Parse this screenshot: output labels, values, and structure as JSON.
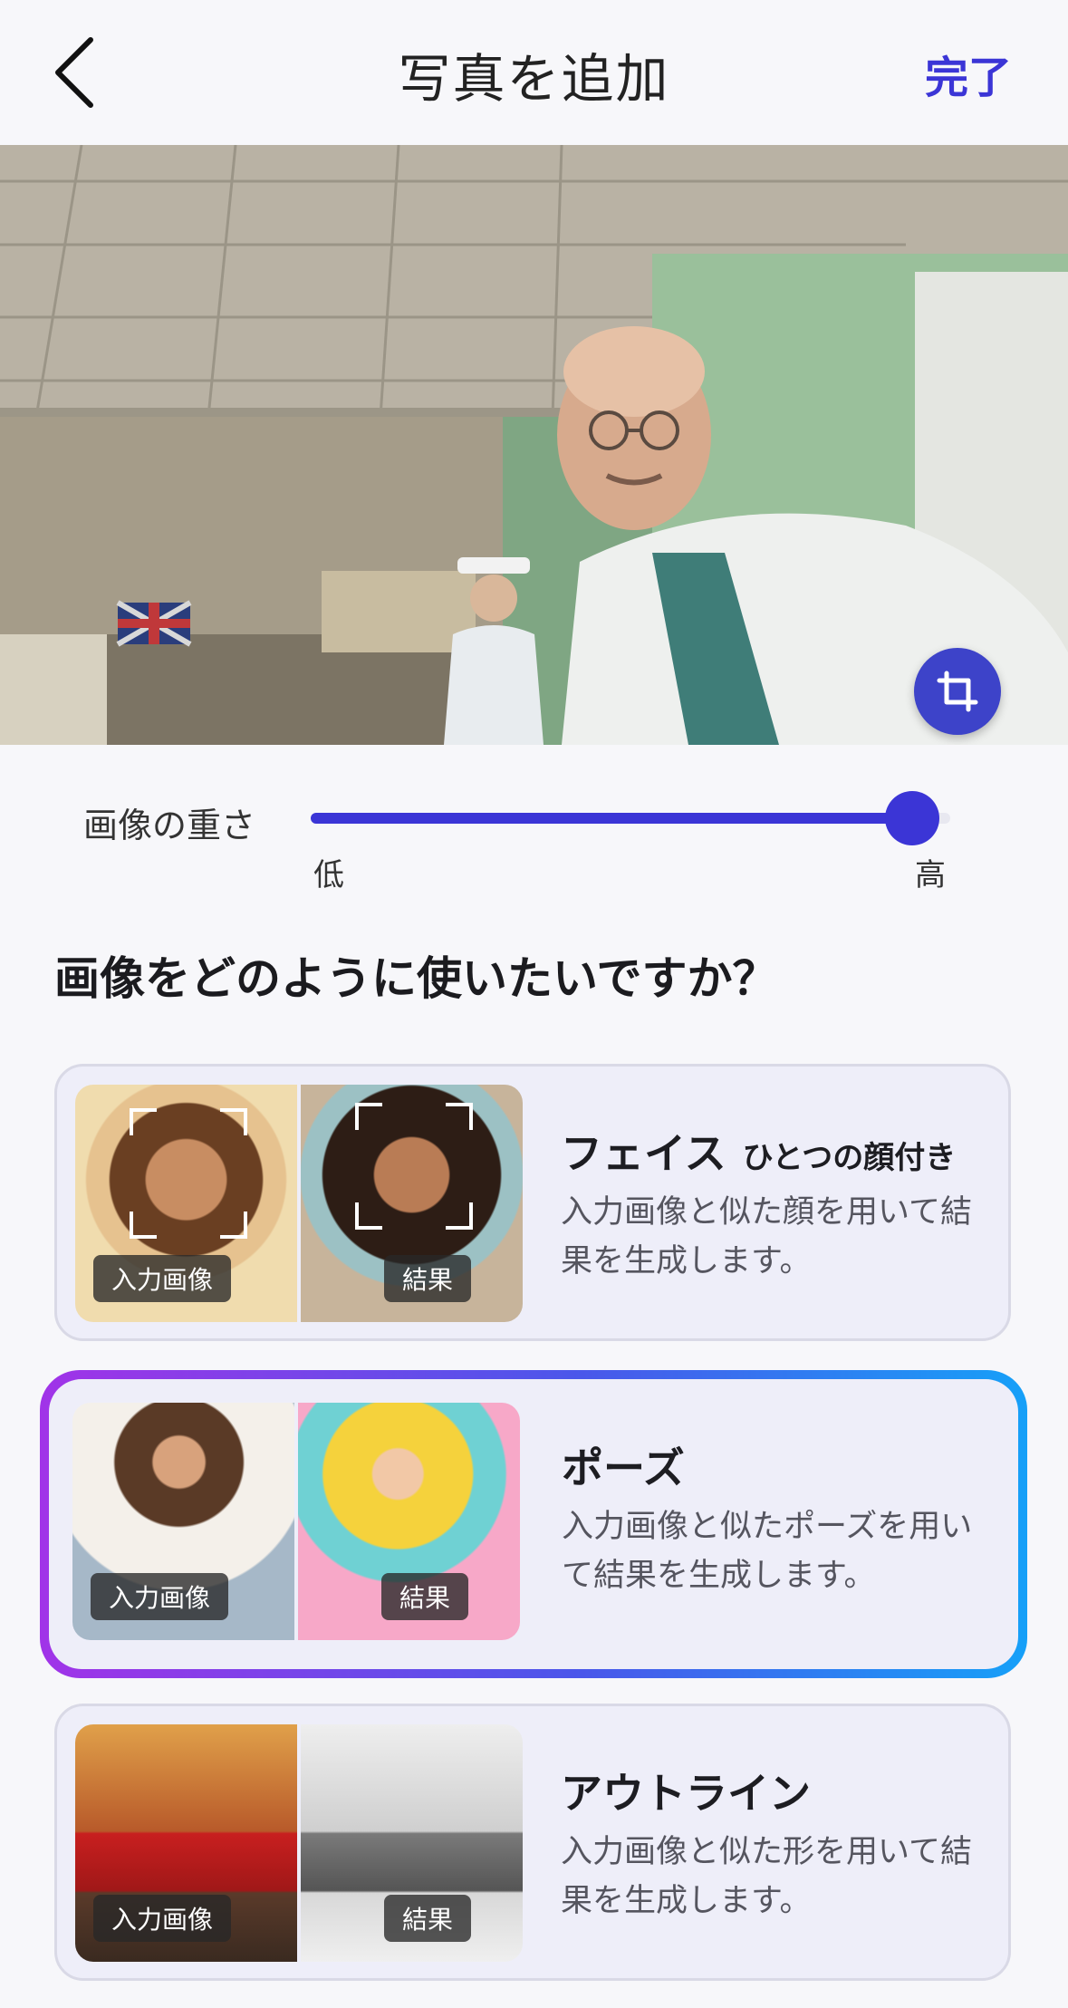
{
  "header": {
    "title": "写真を追加",
    "done_label": "完了"
  },
  "photo": {
    "actions": [
      "crop-icon",
      "replace-image-icon"
    ]
  },
  "weight": {
    "label": "画像の重さ",
    "low_label": "低",
    "high_label": "高",
    "value_fraction": 0.94
  },
  "question": "画像をどのように使いたいですか？",
  "options": [
    {
      "title": "フェイス",
      "subtitle": "ひとつの顔付き",
      "description": "入力画像と似た顔を用いて結果を生成します。",
      "input_tag": "入力画像",
      "result_tag": "結果",
      "selected": false
    },
    {
      "title": "ポーズ",
      "subtitle": "",
      "description": "入力画像と似たポーズを用いて結果を生成します。",
      "input_tag": "入力画像",
      "result_tag": "結果",
      "selected": true
    },
    {
      "title": "アウトライン",
      "subtitle": "",
      "description": "入力画像と似た形を用いて結果を生成します。",
      "input_tag": "入力画像",
      "result_tag": "結果",
      "selected": false
    }
  ],
  "colors": {
    "accent": "#3b35d6",
    "fab": "#3d43c9",
    "card_bg": "#eeeef9",
    "selected_gradient": [
      "#a133e8",
      "#16a0f8"
    ]
  }
}
